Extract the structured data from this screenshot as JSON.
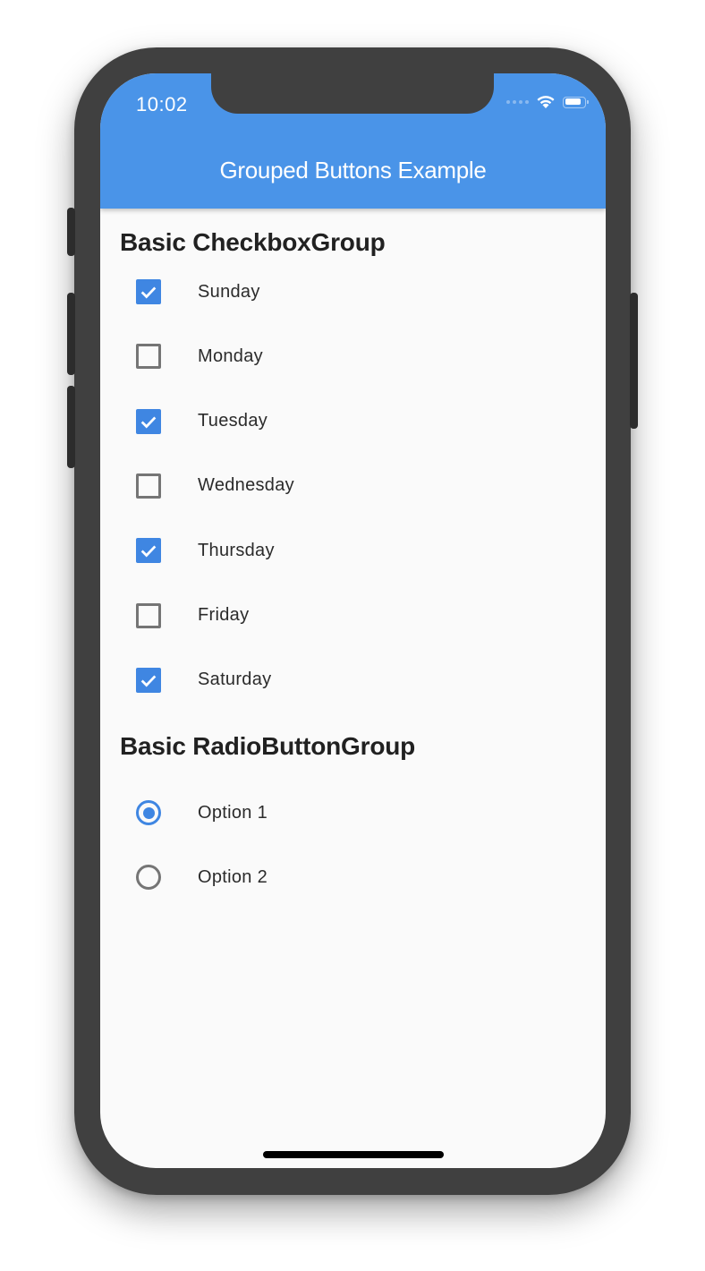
{
  "status_bar": {
    "time": "10:02",
    "icons": [
      "cellular-signal-icon",
      "wifi-icon",
      "battery-icon"
    ]
  },
  "app_bar": {
    "title": "Grouped Buttons Example",
    "color": "#4a94e8"
  },
  "checkbox_group": {
    "title": "Basic CheckboxGroup",
    "items": [
      {
        "label": "Sunday",
        "checked": true
      },
      {
        "label": "Monday",
        "checked": false
      },
      {
        "label": "Tuesday",
        "checked": true
      },
      {
        "label": "Wednesday",
        "checked": false
      },
      {
        "label": "Thursday",
        "checked": true
      },
      {
        "label": "Friday",
        "checked": false
      },
      {
        "label": "Saturday",
        "checked": true
      }
    ]
  },
  "radio_group": {
    "title": "Basic RadioButtonGroup",
    "items": [
      {
        "label": "Option 1",
        "selected": true
      },
      {
        "label": "Option 2",
        "selected": false
      }
    ]
  },
  "colors": {
    "accent": "#3f86e2",
    "unchecked": "#757575",
    "background": "#fafafa"
  }
}
